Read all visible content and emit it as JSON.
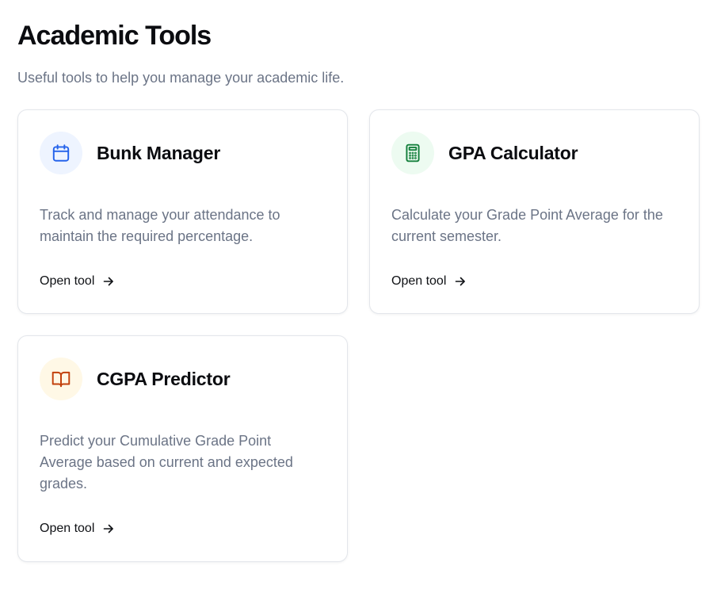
{
  "header": {
    "title": "Academic Tools",
    "subtitle": "Useful tools to help you manage your academic life."
  },
  "tools": [
    {
      "title": "Bunk Manager",
      "description": "Track and manage your attendance to maintain the required percentage.",
      "link_label": "Open tool",
      "icon": "calendar-icon",
      "icon_color": "#2563eb"
    },
    {
      "title": "GPA Calculator",
      "description": "Calculate your Grade Point Average for the current semester.",
      "link_label": "Open tool",
      "icon": "calculator-icon",
      "icon_color": "#15803d"
    },
    {
      "title": "CGPA Predictor",
      "description": "Predict your Cumulative Grade Point Average based on current and expected grades.",
      "link_label": "Open tool",
      "icon": "book-open-icon",
      "icon_color": "#c2410c"
    }
  ]
}
